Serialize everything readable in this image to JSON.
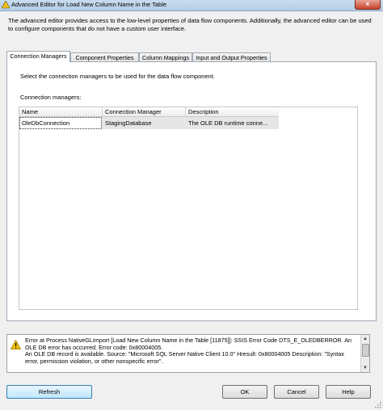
{
  "window": {
    "title": "Advanced Editor for Load New Column Name in the Table",
    "close_label": "x"
  },
  "intro_text": "The advanced editor provides access to the low-level properties of data flow components. Additionally, the advanced editor can be used to configure components that do not have a custom user interface.",
  "tabs": [
    {
      "label": "Connection Managers",
      "active": true
    },
    {
      "label": "Component Properties",
      "active": false
    },
    {
      "label": "Column Mappings",
      "active": false
    },
    {
      "label": "Input and Output Properties",
      "active": false
    }
  ],
  "panel": {
    "instruction": "Select the connection managers to be used for the data flow component.",
    "list_label": "Connection managers:",
    "columns": [
      "Name",
      "Connection Manager",
      "Description"
    ],
    "rows": [
      {
        "name": "OleDbConnection",
        "connection_manager": "StagingDatabase",
        "description": "The OLE DB runtime conne..."
      }
    ]
  },
  "error": {
    "icon": "warning-icon",
    "message": "Error at Process NativeGLImport [Load New Column Name in the Table [11875]]: SSIS Error Code DTS_E_OLEDBERROR.  An OLE DB error has occurred. Error code: 0x80004005.\nAn OLE DB record is available.  Source: \"Microsoft SQL Server Native Client 10.0\"  Hresult: 0x80004005  Description: \"Syntax error, permission violation, or other nonspecific error\"."
  },
  "buttons": {
    "refresh": "Refresh",
    "ok": "OK",
    "cancel": "Cancel",
    "help": "Help"
  },
  "colors": {
    "titlebar": "#c9dcef",
    "selected_row": "#e6e6e6",
    "warning": "#f5c400"
  }
}
